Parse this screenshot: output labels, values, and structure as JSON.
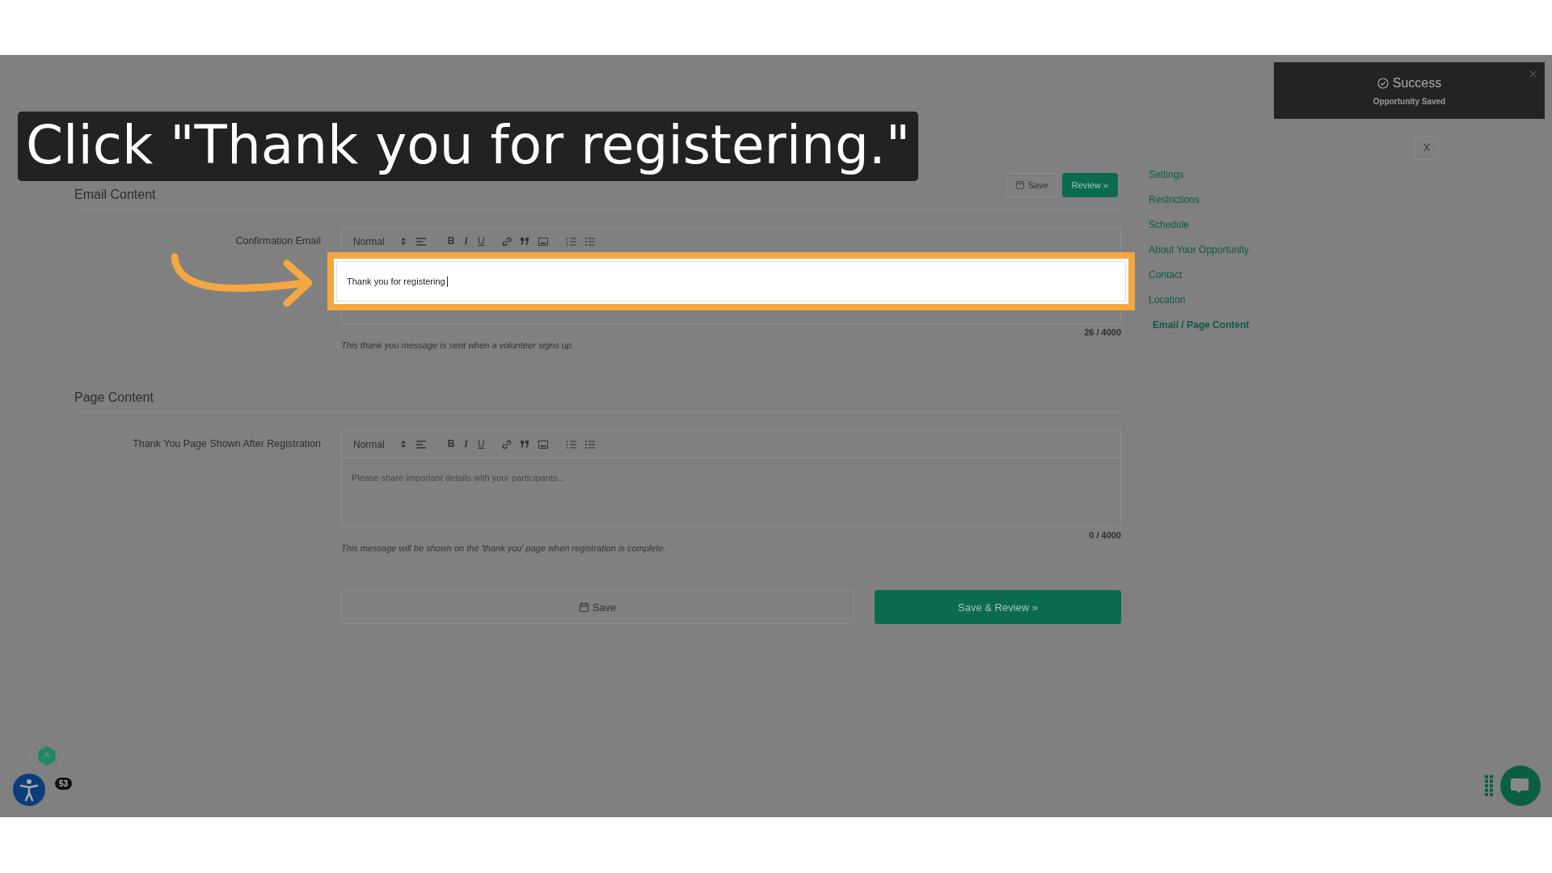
{
  "callout": {
    "text": "Click \"Thank you for registering.\""
  },
  "toast": {
    "title": "Success",
    "message": "Opportunity Saved"
  },
  "header_actions": [
    {
      "label": "Save",
      "kind": "secondary"
    },
    {
      "label": "Review »",
      "kind": "primary"
    }
  ],
  "close_button": "X",
  "sidebar": {
    "items": [
      {
        "label": "Settings",
        "selected": false
      },
      {
        "label": "Restrictions",
        "selected": false
      },
      {
        "label": "Schedule",
        "selected": false
      },
      {
        "label": "About Your Opportunity",
        "selected": false
      },
      {
        "label": "Contact",
        "selected": false
      },
      {
        "label": "Location",
        "selected": false
      },
      {
        "label": "Email / Page Content",
        "selected": true
      }
    ]
  },
  "sections": [
    {
      "heading": "Email Content",
      "label": "Confirmation Email",
      "toolbar": {
        "format": "Normal",
        "buttons": [
          "B",
          "I",
          "U"
        ]
      },
      "value": "Thank you for registering",
      "highlighted": true,
      "counter": "26 / 4000",
      "hint": "This thank you message is sent when a volunteer signs up."
    },
    {
      "heading": "Page Content",
      "label": "Thank You Page Shown After Registration",
      "toolbar": {
        "format": "Normal",
        "buttons": [
          "B",
          "I",
          "U"
        ]
      },
      "placeholder": "Please share important details with your participants...",
      "highlighted": false,
      "counter": "0 / 4000",
      "hint": "This message will be shown on the 'thank you' page when registration is complete."
    }
  ],
  "footer_buttons": [
    {
      "label": "Save",
      "kind": "secondary"
    },
    {
      "label": "Save & Review »",
      "kind": "primary"
    }
  ],
  "notification_badge": "53"
}
